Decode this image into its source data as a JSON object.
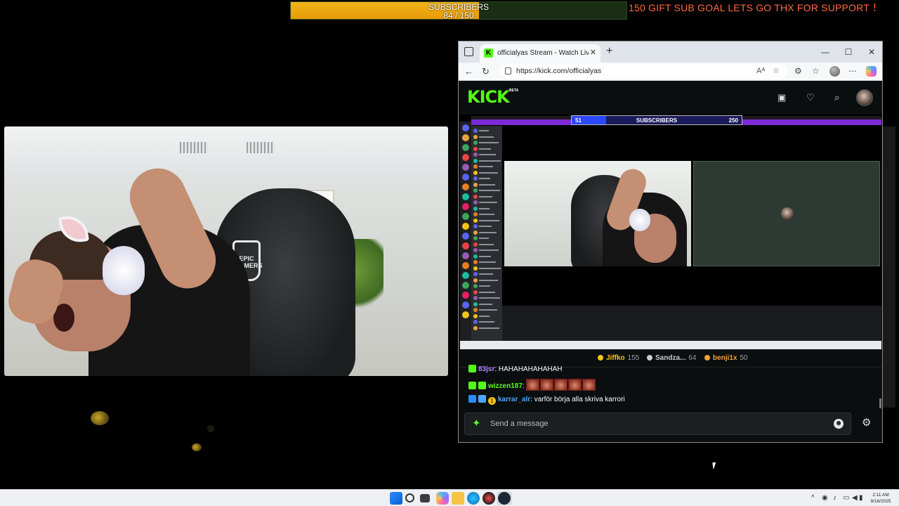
{
  "overlay": {
    "sub_goal": {
      "label": "SUBSCRIBERS",
      "count": "84 / 150",
      "current": 84,
      "target": 150,
      "fill_color": "#f2b418"
    },
    "ticker": "150 GIFT SUB GOAL LETS GO THX FOR SUPPORT ！"
  },
  "webcam": {
    "chair_logo": "EPIC GAMERS"
  },
  "browser": {
    "tab_title": "officialyas Stream - Watch Live on",
    "tab_favicon": "K",
    "tab_close": "✕",
    "new_tab": "+",
    "url": "https://kick.com/officialyas",
    "window_controls": {
      "minimize": "—",
      "maximize": "☐",
      "close": "✕"
    },
    "icons": {
      "back": "←",
      "refresh": "↻",
      "read_aloud": "A͏ᴬ",
      "favorite": "☆",
      "extensions": "⚙",
      "favorites_bar": "☆",
      "more": "⋯"
    }
  },
  "kick": {
    "logo": "KICK",
    "beta": "BETA",
    "header_icons": {
      "following": "▣",
      "favorites": "♡",
      "search": "⌕"
    },
    "inner_sub_goal": {
      "start": "51",
      "label": "SUBSCRIBERS",
      "end": "250"
    },
    "top_gifters": [
      {
        "name": "Jiffko",
        "count": "155",
        "color": "#f5c518"
      },
      {
        "name": "Sandza...",
        "count": "64",
        "color": "#c9ccd1"
      },
      {
        "name": "benji1x",
        "count": "50",
        "color": "#f0a33a"
      }
    ],
    "chat": [
      {
        "user": "83jsr",
        "text": ": HAHAHAHAHAHAH",
        "color": "#b084ff"
      },
      {
        "user": "wizzen187",
        "text": ":",
        "color": "#53fc18",
        "emotes": 5
      },
      {
        "user": "karrar_alr",
        "text": ": varför börja alla skriva karrori",
        "color": "#4ea5ff",
        "badge_count": "1"
      }
    ],
    "chat_input_placeholder": "Send a message",
    "chat_settings_icon": "⚙",
    "emoji_icon": "☻"
  },
  "taskbar": {
    "time": "2:11 AM",
    "date": "9/16/2025"
  }
}
